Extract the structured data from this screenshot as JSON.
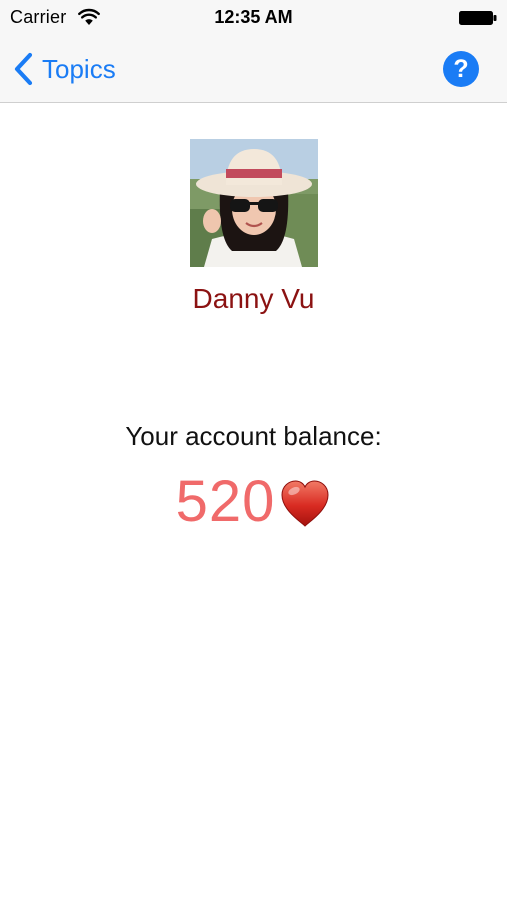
{
  "status_bar": {
    "carrier": "Carrier",
    "time": "12:35 AM",
    "wifi_icon": "wifi-icon",
    "battery_icon": "battery-icon"
  },
  "nav_bar": {
    "back_label": "Topics",
    "back_icon": "chevron-left-icon",
    "help_label": "?",
    "help_icon": "help-icon",
    "accent_color": "#1a7cf5"
  },
  "profile": {
    "name": "Danny Vu",
    "name_color": "#8b1212"
  },
  "balance": {
    "label": "Your account balance:",
    "value": "520",
    "value_color": "#f06a6a",
    "currency_icon": "heart-icon"
  }
}
